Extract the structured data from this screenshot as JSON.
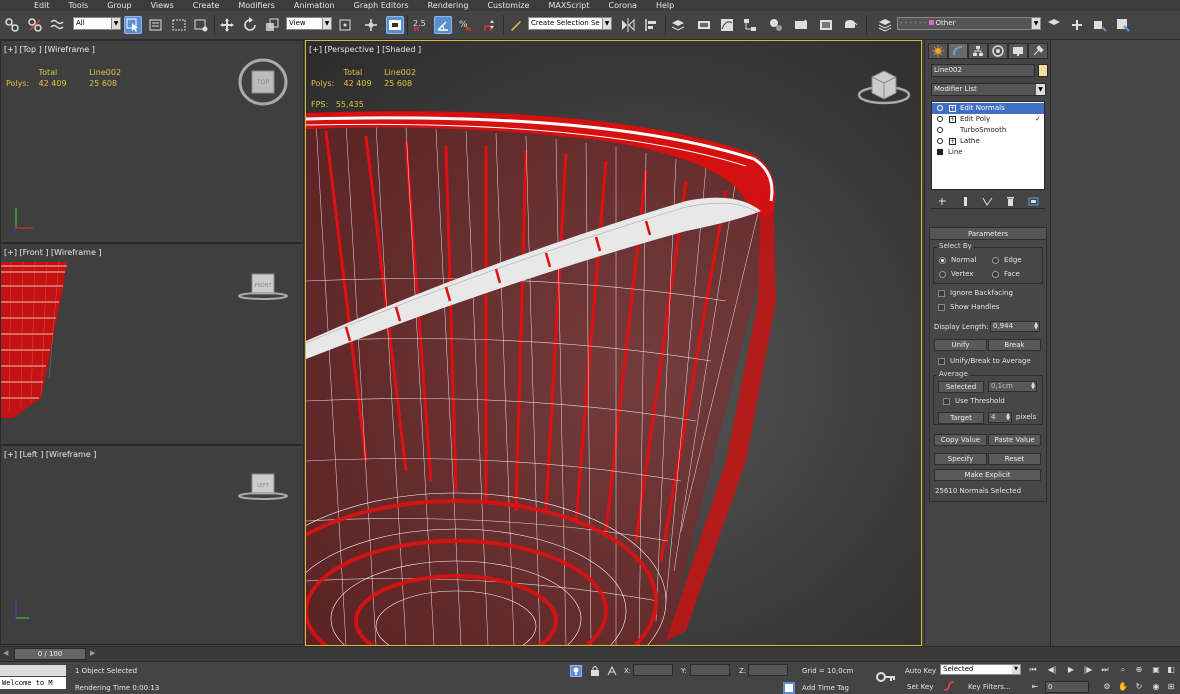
{
  "menu": [
    "Edit",
    "Tools",
    "Group",
    "Views",
    "Create",
    "Modifiers",
    "Animation",
    "Graph Editors",
    "Rendering",
    "Customize",
    "MAXScript",
    "Corona",
    "Help"
  ],
  "toolbar": {
    "selection_filter": "All",
    "ref_coord": "View",
    "snap_value": "2.5",
    "named_selection": "Create Selection Se",
    "layer_name": "Other"
  },
  "viewports": {
    "top": {
      "label": "[+] [Top ] [Wireframe ]",
      "cube_label": "TOP"
    },
    "front": {
      "label": "[+] [Front ] [Wireframe ]",
      "cube_label": "FRONT"
    },
    "left": {
      "label": "[+] [Left ] [Wireframe ]",
      "cube_label": "LEFT"
    },
    "perspective": {
      "label": "[+] [Perspective ] [Shaded ]"
    }
  },
  "stats": {
    "total_label": "Total",
    "object_label": "Line002",
    "polys_label": "Polys:",
    "total_polys": "42 409",
    "object_polys": "25 608",
    "fps_label": "FPS:",
    "fps_value": "55,435"
  },
  "command_panel": {
    "object_name": "Line002",
    "object_color": "#f0e09b",
    "modifier_list_label": "Modifier List",
    "stack": [
      {
        "label": "Edit Normals",
        "selected": true
      },
      {
        "label": "Edit Poly",
        "selected": false
      },
      {
        "label": "TurboSmooth",
        "selected": false
      },
      {
        "label": "Lathe",
        "selected": false
      }
    ],
    "base_object": "Line",
    "parameters": {
      "title": "Parameters",
      "select_by_title": "Select By",
      "normal": "Normal",
      "edge": "Edge",
      "vertex": "Vertex",
      "face": "Face",
      "ignore_backfacing": "Ignore Backfacing",
      "show_handles": "Show Handles",
      "display_length_label": "Display Length:",
      "display_length_value": "0,944",
      "unify": "Unify",
      "break": "Break",
      "unify_break_avg": "Unify/Break to Average",
      "average_title": "Average",
      "selected": "Selected",
      "selected_value": "0,1cm",
      "use_threshold": "Use Threshold",
      "target": "Target",
      "target_value": "4",
      "pixels": "pixels",
      "copy_value": "Copy Value",
      "paste_value": "Paste Value",
      "specify": "Specify",
      "reset": "Reset",
      "make_explicit": "Make Explicit",
      "status": "25610 Normals Selected"
    }
  },
  "timeline": {
    "frame": "0 / 100"
  },
  "statusbar": {
    "maxscript": "Welcome to M",
    "selection_info": "1 Object Selected",
    "render_time": "Rendering Time  0:00:13",
    "x_label": "X:",
    "y_label": "Y:",
    "z_label": "Z:",
    "grid": "Grid = 10,0cm",
    "add_time_tag": "Add Time Tag",
    "auto_key": "Auto Key",
    "set_key": "Set Key",
    "key_mode": "Selected",
    "key_filters": "Key Filters...",
    "current_frame": "0"
  },
  "colors": {
    "accent": "#d6b93a",
    "normals": "#e01010",
    "wire": "#ffffff",
    "selection_blue": "#3d6fc4"
  }
}
